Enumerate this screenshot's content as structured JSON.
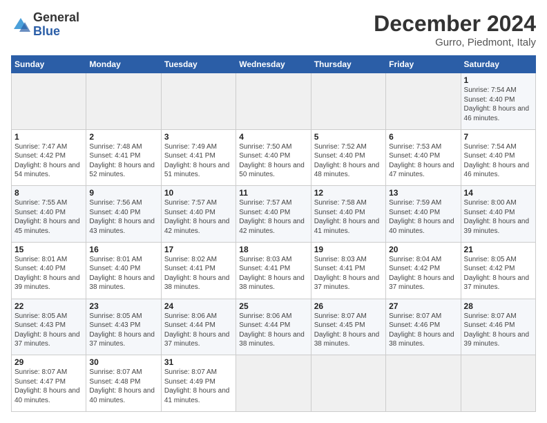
{
  "header": {
    "logo_general": "General",
    "logo_blue": "Blue",
    "main_title": "December 2024",
    "subtitle": "Gurro, Piedmont, Italy"
  },
  "calendar": {
    "days_of_week": [
      "Sunday",
      "Monday",
      "Tuesday",
      "Wednesday",
      "Thursday",
      "Friday",
      "Saturday"
    ],
    "weeks": [
      [
        {
          "day": "",
          "empty": true
        },
        {
          "day": "",
          "empty": true
        },
        {
          "day": "",
          "empty": true
        },
        {
          "day": "",
          "empty": true
        },
        {
          "day": "",
          "empty": true
        },
        {
          "day": "",
          "empty": true
        },
        {
          "day": "1",
          "sunrise": "Sunrise: 7:54 AM",
          "sunset": "Sunset: 4:40 PM",
          "daylight": "Daylight: 8 hours and 46 minutes."
        }
      ],
      [
        {
          "day": "1",
          "sunrise": "Sunrise: 7:47 AM",
          "sunset": "Sunset: 4:42 PM",
          "daylight": "Daylight: 8 hours and 54 minutes."
        },
        {
          "day": "2",
          "sunrise": "Sunrise: 7:48 AM",
          "sunset": "Sunset: 4:41 PM",
          "daylight": "Daylight: 8 hours and 52 minutes."
        },
        {
          "day": "3",
          "sunrise": "Sunrise: 7:49 AM",
          "sunset": "Sunset: 4:41 PM",
          "daylight": "Daylight: 8 hours and 51 minutes."
        },
        {
          "day": "4",
          "sunrise": "Sunrise: 7:50 AM",
          "sunset": "Sunset: 4:40 PM",
          "daylight": "Daylight: 8 hours and 50 minutes."
        },
        {
          "day": "5",
          "sunrise": "Sunrise: 7:52 AM",
          "sunset": "Sunset: 4:40 PM",
          "daylight": "Daylight: 8 hours and 48 minutes."
        },
        {
          "day": "6",
          "sunrise": "Sunrise: 7:53 AM",
          "sunset": "Sunset: 4:40 PM",
          "daylight": "Daylight: 8 hours and 47 minutes."
        },
        {
          "day": "7",
          "sunrise": "Sunrise: 7:54 AM",
          "sunset": "Sunset: 4:40 PM",
          "daylight": "Daylight: 8 hours and 46 minutes."
        }
      ],
      [
        {
          "day": "8",
          "sunrise": "Sunrise: 7:55 AM",
          "sunset": "Sunset: 4:40 PM",
          "daylight": "Daylight: 8 hours and 45 minutes."
        },
        {
          "day": "9",
          "sunrise": "Sunrise: 7:56 AM",
          "sunset": "Sunset: 4:40 PM",
          "daylight": "Daylight: 8 hours and 43 minutes."
        },
        {
          "day": "10",
          "sunrise": "Sunrise: 7:57 AM",
          "sunset": "Sunset: 4:40 PM",
          "daylight": "Daylight: 8 hours and 42 minutes."
        },
        {
          "day": "11",
          "sunrise": "Sunrise: 7:57 AM",
          "sunset": "Sunset: 4:40 PM",
          "daylight": "Daylight: 8 hours and 42 minutes."
        },
        {
          "day": "12",
          "sunrise": "Sunrise: 7:58 AM",
          "sunset": "Sunset: 4:40 PM",
          "daylight": "Daylight: 8 hours and 41 minutes."
        },
        {
          "day": "13",
          "sunrise": "Sunrise: 7:59 AM",
          "sunset": "Sunset: 4:40 PM",
          "daylight": "Daylight: 8 hours and 40 minutes."
        },
        {
          "day": "14",
          "sunrise": "Sunrise: 8:00 AM",
          "sunset": "Sunset: 4:40 PM",
          "daylight": "Daylight: 8 hours and 39 minutes."
        }
      ],
      [
        {
          "day": "15",
          "sunrise": "Sunrise: 8:01 AM",
          "sunset": "Sunset: 4:40 PM",
          "daylight": "Daylight: 8 hours and 39 minutes."
        },
        {
          "day": "16",
          "sunrise": "Sunrise: 8:01 AM",
          "sunset": "Sunset: 4:40 PM",
          "daylight": "Daylight: 8 hours and 38 minutes."
        },
        {
          "day": "17",
          "sunrise": "Sunrise: 8:02 AM",
          "sunset": "Sunset: 4:41 PM",
          "daylight": "Daylight: 8 hours and 38 minutes."
        },
        {
          "day": "18",
          "sunrise": "Sunrise: 8:03 AM",
          "sunset": "Sunset: 4:41 PM",
          "daylight": "Daylight: 8 hours and 38 minutes."
        },
        {
          "day": "19",
          "sunrise": "Sunrise: 8:03 AM",
          "sunset": "Sunset: 4:41 PM",
          "daylight": "Daylight: 8 hours and 37 minutes."
        },
        {
          "day": "20",
          "sunrise": "Sunrise: 8:04 AM",
          "sunset": "Sunset: 4:42 PM",
          "daylight": "Daylight: 8 hours and 37 minutes."
        },
        {
          "day": "21",
          "sunrise": "Sunrise: 8:05 AM",
          "sunset": "Sunset: 4:42 PM",
          "daylight": "Daylight: 8 hours and 37 minutes."
        }
      ],
      [
        {
          "day": "22",
          "sunrise": "Sunrise: 8:05 AM",
          "sunset": "Sunset: 4:43 PM",
          "daylight": "Daylight: 8 hours and 37 minutes."
        },
        {
          "day": "23",
          "sunrise": "Sunrise: 8:05 AM",
          "sunset": "Sunset: 4:43 PM",
          "daylight": "Daylight: 8 hours and 37 minutes."
        },
        {
          "day": "24",
          "sunrise": "Sunrise: 8:06 AM",
          "sunset": "Sunset: 4:44 PM",
          "daylight": "Daylight: 8 hours and 37 minutes."
        },
        {
          "day": "25",
          "sunrise": "Sunrise: 8:06 AM",
          "sunset": "Sunset: 4:44 PM",
          "daylight": "Daylight: 8 hours and 38 minutes."
        },
        {
          "day": "26",
          "sunrise": "Sunrise: 8:07 AM",
          "sunset": "Sunset: 4:45 PM",
          "daylight": "Daylight: 8 hours and 38 minutes."
        },
        {
          "day": "27",
          "sunrise": "Sunrise: 8:07 AM",
          "sunset": "Sunset: 4:46 PM",
          "daylight": "Daylight: 8 hours and 38 minutes."
        },
        {
          "day": "28",
          "sunrise": "Sunrise: 8:07 AM",
          "sunset": "Sunset: 4:46 PM",
          "daylight": "Daylight: 8 hours and 39 minutes."
        }
      ],
      [
        {
          "day": "29",
          "sunrise": "Sunrise: 8:07 AM",
          "sunset": "Sunset: 4:47 PM",
          "daylight": "Daylight: 8 hours and 40 minutes."
        },
        {
          "day": "30",
          "sunrise": "Sunrise: 8:07 AM",
          "sunset": "Sunset: 4:48 PM",
          "daylight": "Daylight: 8 hours and 40 minutes."
        },
        {
          "day": "31",
          "sunrise": "Sunrise: 8:07 AM",
          "sunset": "Sunset: 4:49 PM",
          "daylight": "Daylight: 8 hours and 41 minutes."
        },
        {
          "day": "",
          "empty": true
        },
        {
          "day": "",
          "empty": true
        },
        {
          "day": "",
          "empty": true
        },
        {
          "day": "",
          "empty": true
        }
      ]
    ]
  }
}
